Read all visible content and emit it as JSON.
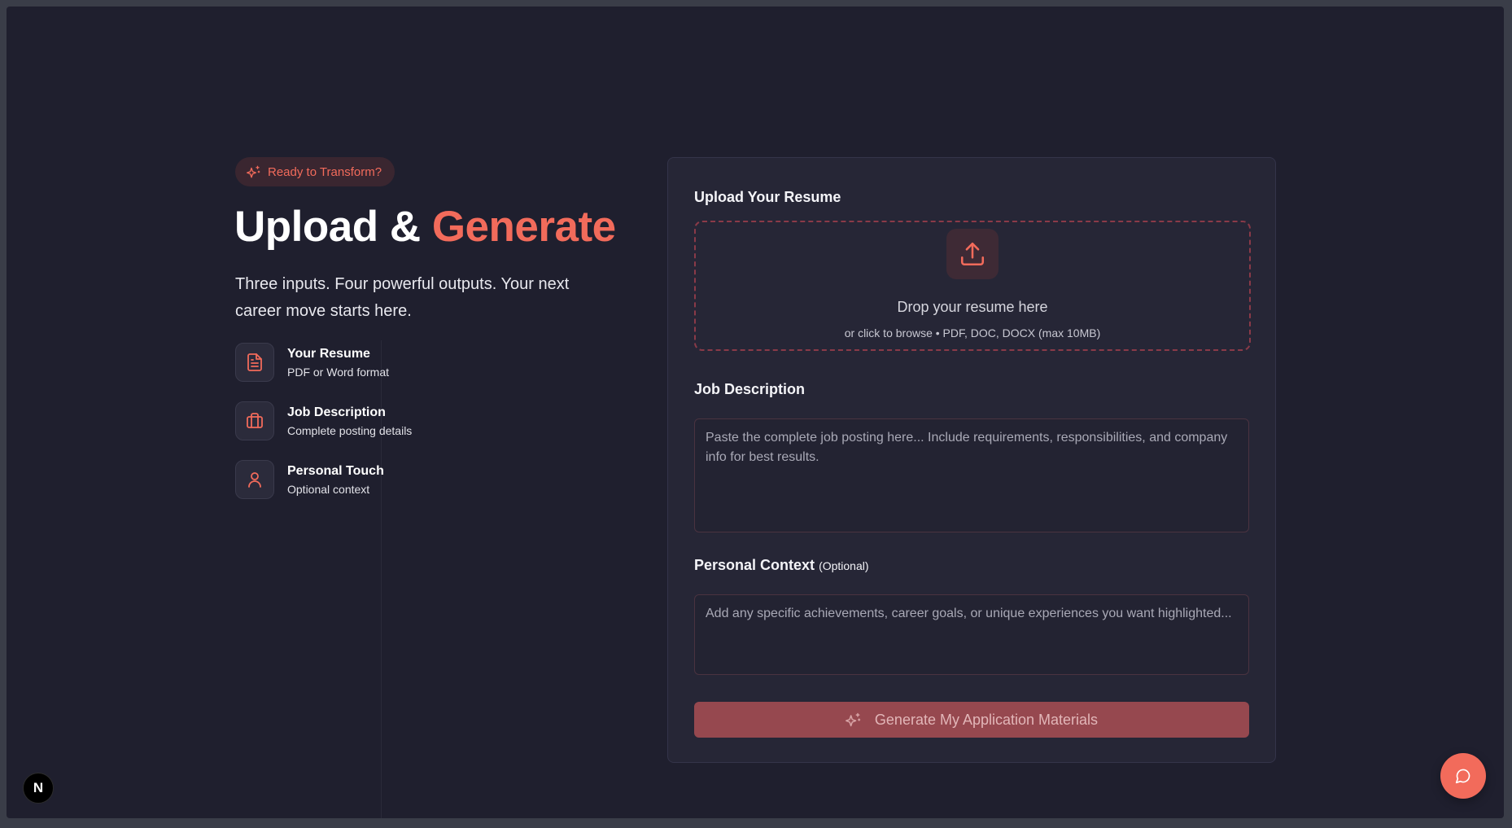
{
  "colors": {
    "accent": "#f26b5b",
    "background": "#1f1f2e",
    "card": "#262636",
    "button_disabled": "#96484f"
  },
  "hero": {
    "badge": {
      "icon": "sparkles-icon",
      "label": "Ready to Transform?"
    },
    "title_main": "Upload & ",
    "title_accent": "Generate",
    "subtitle": "Three inputs. Four powerful outputs. Your next career move starts here."
  },
  "features": [
    {
      "icon": "file-text-icon",
      "title": "Your Resume",
      "desc": "PDF or Word format"
    },
    {
      "icon": "briefcase-icon",
      "title": "Job Description",
      "desc": "Complete posting details"
    },
    {
      "icon": "user-icon",
      "title": "Personal Touch",
      "desc": "Optional context"
    }
  ],
  "form": {
    "upload": {
      "label": "Upload Your Resume",
      "icon": "upload-icon",
      "drop_title": "Drop your resume here",
      "drop_sub": "or click to browse • PDF, DOC, DOCX (max 10MB)"
    },
    "job": {
      "label": "Job Description",
      "placeholder": "Paste the complete job posting here... Include requirements, responsibilities, and company info for best results.",
      "value": ""
    },
    "personal": {
      "label": "Personal Context",
      "optional": "(Optional)",
      "placeholder": "Add any specific achievements, career goals, or unique experiences you want highlighted...",
      "value": ""
    },
    "submit": {
      "icon": "sparkles-icon",
      "label": "Generate My Application Materials",
      "disabled": true
    }
  },
  "floating": {
    "next_badge": "N",
    "chat_icon": "message-circle-icon"
  }
}
